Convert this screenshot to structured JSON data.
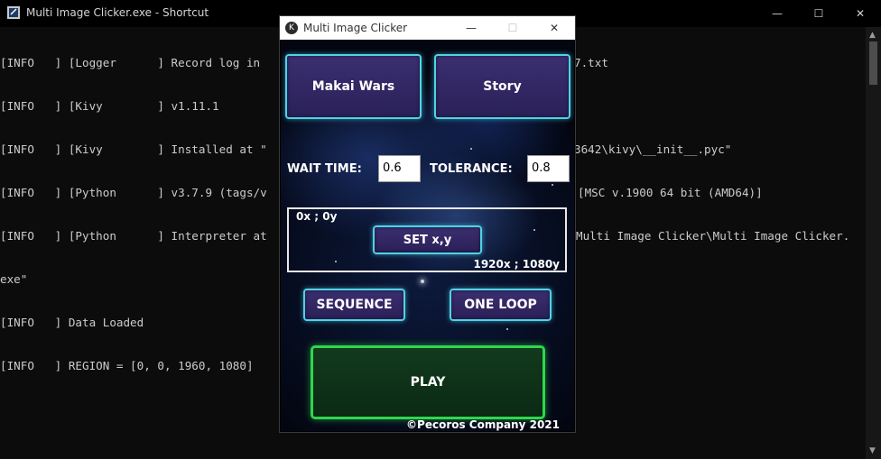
{
  "console": {
    "title": "Multi Image Clicker.exe - Shortcut",
    "minimize": "—",
    "maximize": "☐",
    "close": "✕",
    "lines": [
      "[INFO   ] [Logger      ] Record log in ",
      "[INFO   ] [Kivy        ] v1.11.1",
      "[INFO   ] [Kivy        ] Installed at \"",
      "[INFO   ] [Python      ] v3.7.9 (tags/v",
      "[INFO   ] [Python      ] Interpreter at",
      "exe\"",
      "[INFO   ] Data Loaded",
      "[INFO   ] REGION = [0, 0, 1960, 1080]"
    ],
    "line_tails": [
      "7.txt",
      "",
      "3642\\kivy\\__init__.pyc\"",
      "[MSC v.1900 64 bit (AMD64)]",
      "Multi Image Clicker\\Multi Image Clicker.",
      "",
      "",
      ""
    ]
  },
  "app": {
    "title": "Multi Image Clicker",
    "icon": "kivy-icon",
    "controls": {
      "minimize": "—",
      "maximize": "☐",
      "close": "✕"
    },
    "buttons": {
      "game1": "Makai Wars",
      "game2": "Story",
      "set_xy": "SET x,y",
      "sequence": "SEQUENCE",
      "one_loop": "ONE LOOP",
      "play": "PLAY"
    },
    "wait_time": {
      "label": "WAIT TIME:",
      "value": "0.6"
    },
    "tolerance": {
      "label": "TOLERANCE:",
      "value": "0.8"
    },
    "coords": {
      "current": "0x ; 0y",
      "resolution": "1920x ; 1080y"
    },
    "footer": "©Pecoros Company 2021",
    "colors": {
      "button_border": "#4fd2e8",
      "button_fill": "#2f2563",
      "play_border": "#2fd64d"
    }
  }
}
